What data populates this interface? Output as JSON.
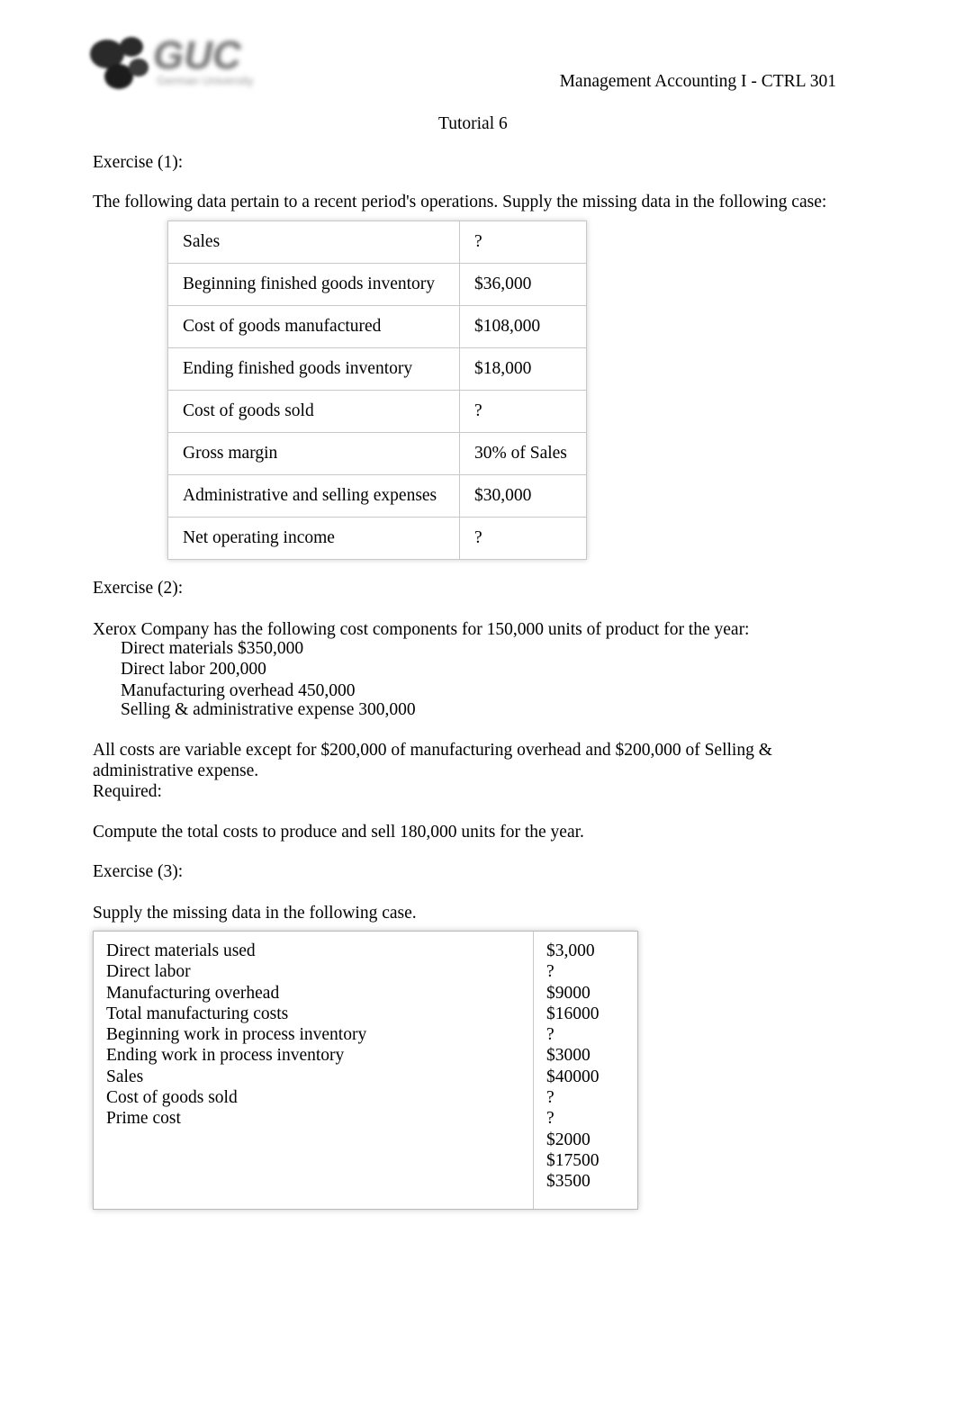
{
  "header": {
    "course": "Management Accounting I - CTRL 301",
    "tutorial": "Tutorial 6",
    "logo_text": "GUC"
  },
  "exercise1": {
    "label": "Exercise (1):",
    "intro": "The following data pertain to a recent period's operations. Supply the missing data in the following case:",
    "rows": [
      {
        "item": "Sales",
        "value": "?"
      },
      {
        "item": "Beginning finished goods inventory",
        "value": "$36,000"
      },
      {
        "item": "Cost of goods manufactured",
        "value": "$108,000"
      },
      {
        "item": "Ending finished goods inventory",
        "value": "$18,000"
      },
      {
        "item": "Cost of goods sold",
        "value": "?"
      },
      {
        "item": "Gross margin",
        "value": "30% of Sales"
      },
      {
        "item": "Administrative and selling expenses",
        "value": "$30,000"
      },
      {
        "item": "Net operating income",
        "value": "?"
      }
    ]
  },
  "exercise2": {
    "label": "Exercise (2):",
    "intro": "Xerox Company has the following cost components for 150,000 units of product for the year:",
    "cost_lines": [
      "Direct materials $350,000",
      "Direct labor 200,000",
      "Manufacturing overhead 450,000",
      "Selling & administrative expense 300,000"
    ],
    "note_line1": "All costs are variable except for $200,000 of manufacturing overhead and $200,000 of Selling &",
    "note_line2": "administrative expense.",
    "required_label": "Required:",
    "required_text": "Compute the total costs to produce and sell 180,000 units for the year."
  },
  "exercise3": {
    "label": "Exercise (3):",
    "intro": "Supply the missing data in the following case.",
    "items": [
      "Direct materials used",
      "Direct labor",
      "Manufacturing overhead",
      "Total manufacturing costs",
      "Beginning work in process inventory",
      "Ending work in process inventory",
      "Sales",
      "Cost of goods sold",
      "Prime cost"
    ],
    "values": [
      "$3,000",
      "?",
      "$9000",
      "$16000",
      "?",
      "$3000",
      "$40000",
      "?",
      "?",
      "$2000",
      "$17500",
      "$3500"
    ]
  }
}
